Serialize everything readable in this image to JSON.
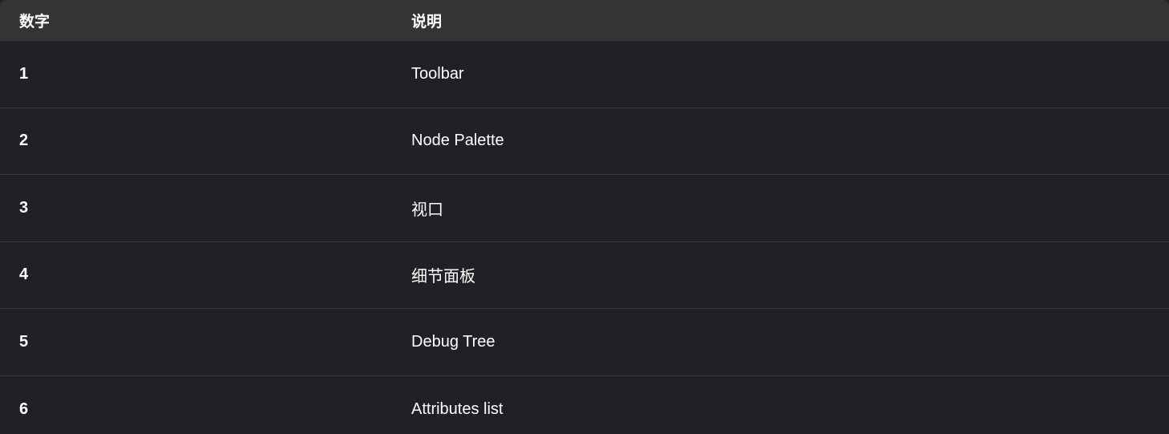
{
  "table": {
    "headers": [
      "数字",
      "说明"
    ],
    "rows": [
      {
        "number": "1",
        "description": "Toolbar"
      },
      {
        "number": "2",
        "description": "Node Palette"
      },
      {
        "number": "3",
        "description": "视口"
      },
      {
        "number": "4",
        "description": "细节面板"
      },
      {
        "number": "5",
        "description": "Debug Tree"
      },
      {
        "number": "6",
        "description": "Attributes list"
      }
    ]
  }
}
